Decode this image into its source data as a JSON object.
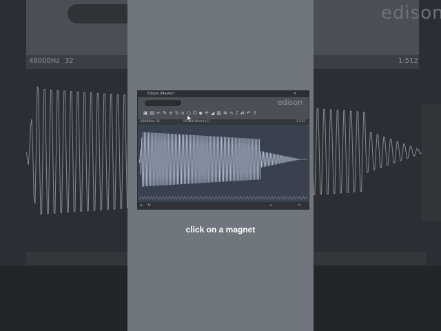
{
  "background_app": {
    "logo": "edison",
    "sample_rate": "48000Hz",
    "bits": "32",
    "zoom_readout": "1:512"
  },
  "window": {
    "title": "Edison (Master)",
    "logo": "edison",
    "sample_rate": "48000Hz",
    "bits": "32",
    "clip_label": "56,800 Mixed (C)",
    "zoom_readout": "1:512",
    "icons": [
      "save-icon",
      "copy-icon",
      "cut-icon",
      "wrench-icon",
      "tune-icon",
      "loop-icon",
      "magnet-icon",
      "zoom-icon",
      "power-icon",
      "marker-icon",
      "crosshair-icon",
      "fade-icon",
      "eq-icon",
      "gear-icon",
      "waveform-icon",
      "mic-icon",
      "swap-icon",
      "undo-icon",
      "export-icon"
    ]
  },
  "caption": "click on a magnet",
  "colors": {
    "strip": "#6f767d",
    "waveform": "#aab8cc",
    "background": "#2c3036"
  }
}
